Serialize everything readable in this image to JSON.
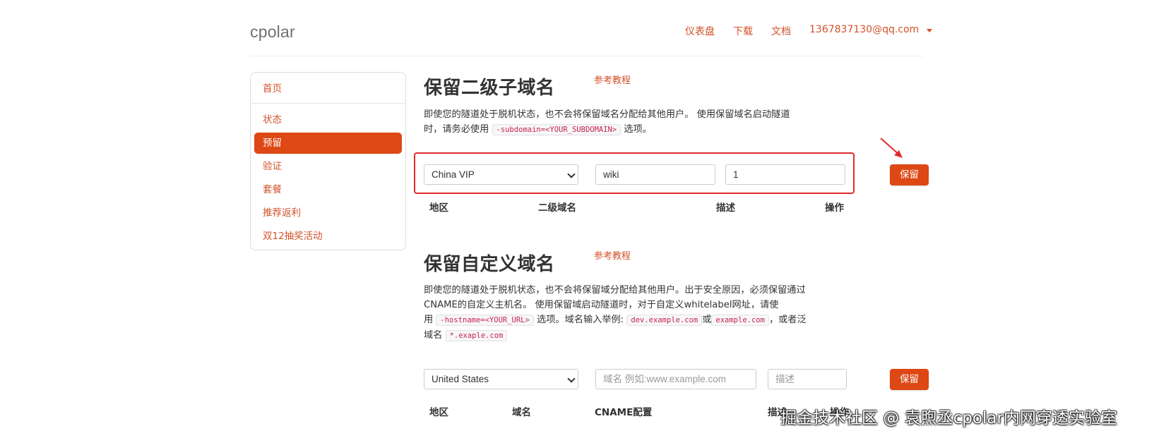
{
  "header": {
    "logo": "cpolar",
    "nav": {
      "dashboard": "仪表盘",
      "download": "下载",
      "docs": "文档",
      "user": "1367837130@qq.com"
    }
  },
  "sidebar": {
    "items": [
      {
        "label": "首页"
      },
      {
        "label": "状态"
      },
      {
        "label": "预留",
        "active": true
      },
      {
        "label": "验证"
      },
      {
        "label": "套餐"
      },
      {
        "label": "推荐返利"
      },
      {
        "label": "双12抽奖活动"
      }
    ]
  },
  "subdomain_section": {
    "title": "保留二级子域名",
    "tutorial_link": "参考教程",
    "desc_line1": "即使您的隧道处于脱机状态，也不会将保留域名分配给其他用户。 使用保留域名启动隧道",
    "desc_line2_pre": "时，请务必使用",
    "desc_code": "-subdomain=<YOUR_SUBDOMAIN>",
    "desc_line2_post": "选项。",
    "region_value": "China VIP",
    "subdomain_value": "wiki",
    "description_value": "1",
    "save_label": "保留",
    "columns": {
      "region": "地区",
      "subdomain": "二级域名",
      "description": "描述",
      "action": "操作"
    }
  },
  "custom_domain_section": {
    "title": "保留自定义域名",
    "tutorial_link": "参考教程",
    "desc_line1": "即使您的隧道处于脱机状态，也不会将保留域分配给其他用户。出于安全原因，必须保留通过",
    "desc_line2": "CNAME的自定义主机名。 使用保留域启动隧道时，对于自定义whitelabel网址，请使",
    "desc_line3_pre": "用",
    "desc_code1": "-hostname=<YOUR_URL>",
    "desc_line3_mid": "选项。域名输入举例:",
    "desc_code2": "dev.example.com",
    "desc_line3_or": "或",
    "desc_code3": "example.com",
    "desc_line3_post": "，或者泛",
    "desc_line4_pre": "域名",
    "desc_code4": "*.exaple.com",
    "region_value": "United States",
    "domain_placeholder": "域名 例如:www.example.com",
    "description_placeholder": "描述",
    "save_label": "保留",
    "columns": {
      "region": "地区",
      "domain": "域名",
      "cname": "CNAME配置",
      "description": "描述",
      "action": "操作"
    }
  },
  "watermark": "掘金技术社区 @ 袁煦丞cpolar内网穿透实验室",
  "colors": {
    "accent": "#dd4814",
    "link": "#d2522a",
    "highlight_box": "#e12a2a"
  }
}
